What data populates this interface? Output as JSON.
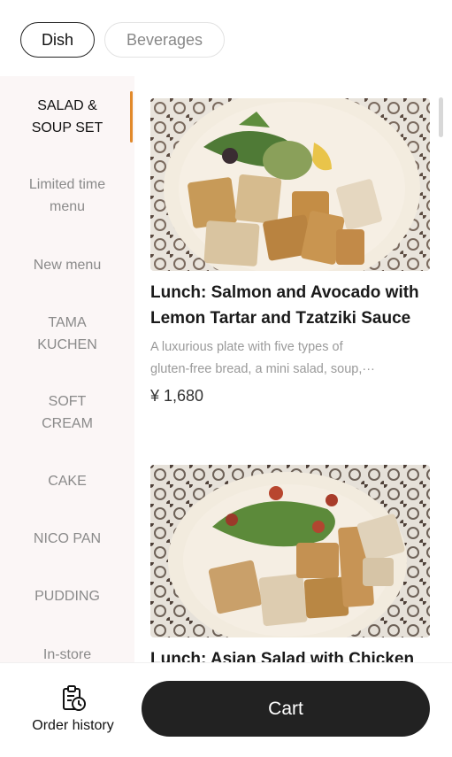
{
  "tabs": [
    {
      "label": "Dish",
      "selected": true
    },
    {
      "label": "Beverages",
      "selected": false
    }
  ],
  "sidebar": {
    "items": [
      {
        "label": "SALAD & SOUP SET",
        "active": true
      },
      {
        "label": "Limited time menu"
      },
      {
        "label": "New menu"
      },
      {
        "label": "TAMA KUCHEN"
      },
      {
        "label": "SOFT CREAM"
      },
      {
        "label": "CAKE"
      },
      {
        "label": "NICO PAN"
      },
      {
        "label": "PUDDING"
      },
      {
        "label": "In-store"
      }
    ]
  },
  "items": [
    {
      "name": "Lunch: Salmon and Avocado with Lemon Tartar and Tzatziki Sauce",
      "description_line1": "A luxurious plate with five types of",
      "description_line2": "gluten-free bread, a mini salad, soup,···",
      "price": "¥ 1,680"
    },
    {
      "name": "Lunch: Asian Salad with Chicken"
    }
  ],
  "bottom": {
    "order_history_label": "Order history",
    "cart_label": "Cart"
  },
  "colors": {
    "accent": "#e28a2b",
    "sidebar_bg": "#fbf6f6",
    "cart_bg": "#222222"
  },
  "icons": {
    "order_history": "clipboard-clock-icon"
  }
}
